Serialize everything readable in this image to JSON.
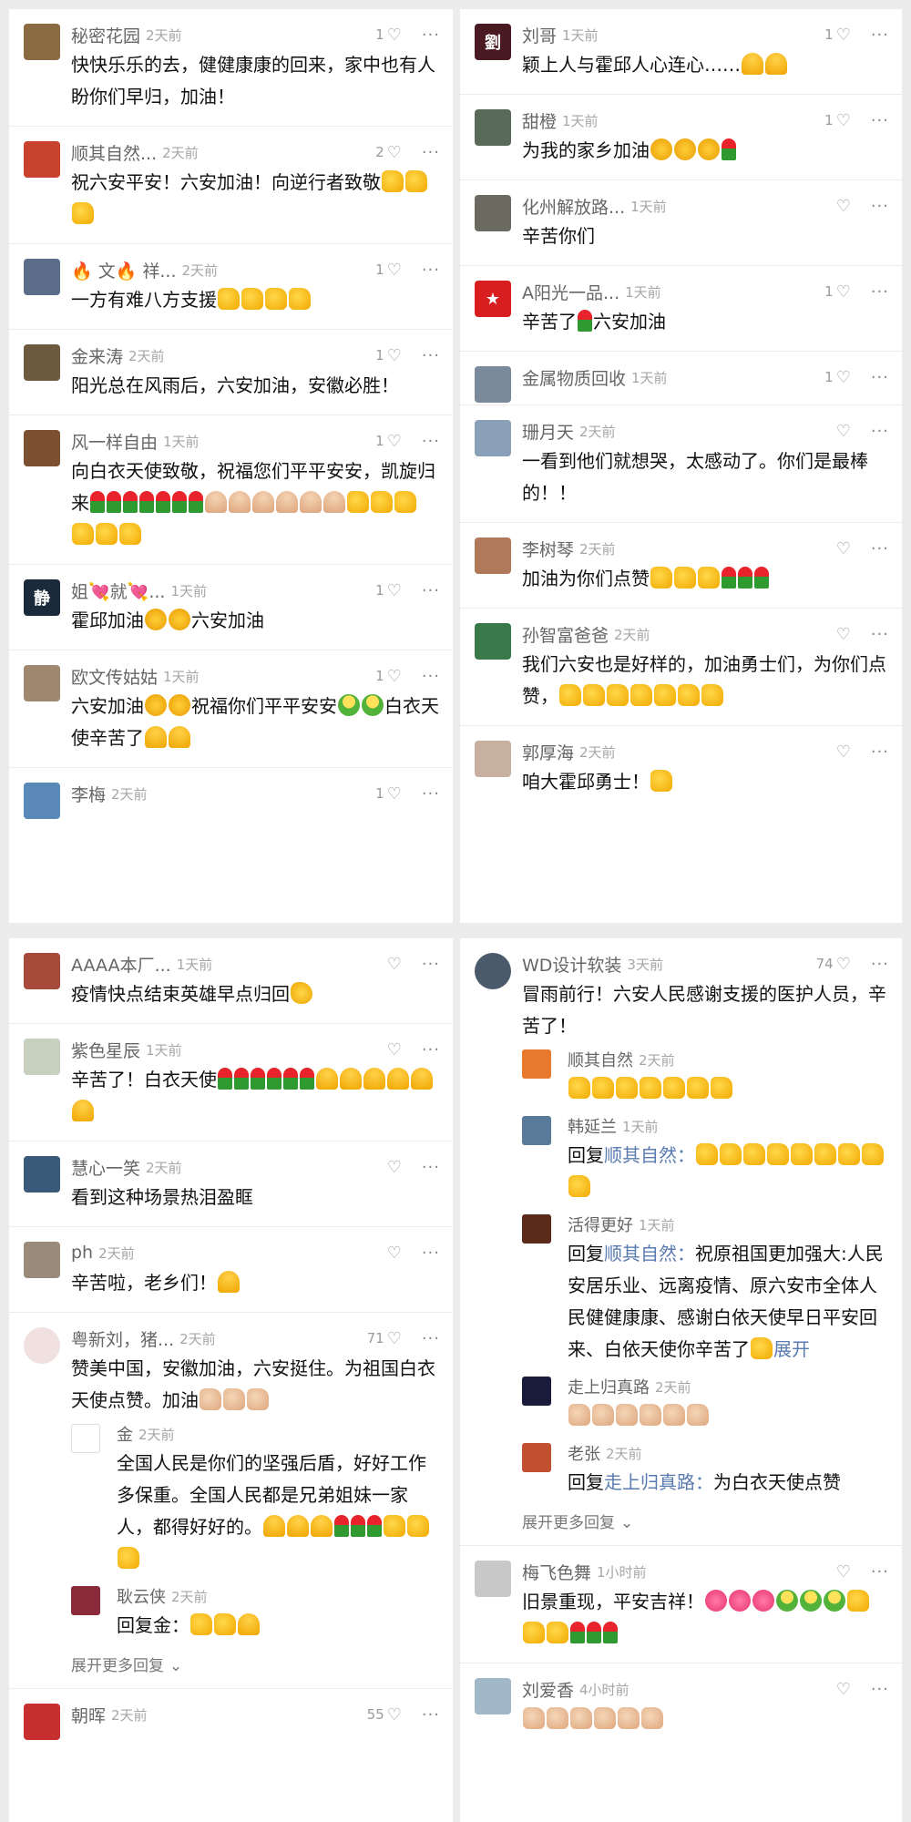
{
  "p1": [
    {
      "name": "秘密花园",
      "time": "2天前",
      "likes": "1",
      "text": "快快乐乐的去，健健康康的回来，家中也有人盼你们早归，加油！",
      "emojis": [],
      "av": "#8a6a40"
    },
    {
      "name": "顺其自然...",
      "time": "2天前",
      "likes": "2",
      "text": "祝六安平安！六安加油！向逆行者致敬",
      "emojis": [
        "thumb",
        "thumb",
        "thumb"
      ],
      "av": "#c8422e"
    },
    {
      "name": "🔥 文🔥 祥...",
      "time": "2天前",
      "likes": "1",
      "text": "一方有难八方支援",
      "emojis": [
        "thumb",
        "thumb",
        "thumb",
        "thumb"
      ],
      "av": "#5b6d88"
    },
    {
      "name": "金来涛",
      "time": "2天前",
      "likes": "1",
      "text": "阳光总在风雨后，六安加油，安徽必胜！",
      "emojis": [],
      "av": "#6b5a3e"
    },
    {
      "name": "风一样自由",
      "time": "1天前",
      "likes": "1",
      "text": "向白衣天使致敬，祝福您们平平安安，凯旋归来",
      "emojis": [
        "rose",
        "rose",
        "rose",
        "rose",
        "rose",
        "rose",
        "rose",
        "prayb",
        "prayb",
        "prayb",
        "prayb",
        "prayb",
        "prayb",
        "thumb",
        "thumb",
        "thumb",
        "thumb",
        "thumb",
        "thumb"
      ],
      "av": "#7a5030"
    },
    {
      "name": "姐💘就💘...",
      "time": "1天前",
      "likes": "1",
      "text": "霍邱加油",
      "emojis": [
        "fist",
        "fist"
      ],
      "text2": "六安加油",
      "av": "#1a2a3a",
      "avtext": "静"
    },
    {
      "name": "欧文传姑姑",
      "time": "1天前",
      "likes": "1",
      "text": "六安加油",
      "emojis": [
        "fist",
        "fist"
      ],
      "text2": "祝福你们平平安安",
      "emojis2": [
        "face",
        "face"
      ],
      "text3": "白衣天使辛苦了",
      "emojis3": [
        "pray",
        "pray"
      ],
      "av": "#a08870"
    },
    {
      "name": "李梅",
      "time": "2天前",
      "likes": "1",
      "text": "",
      "emojis": [],
      "av": "#5a88b8"
    }
  ],
  "p2": [
    {
      "name": "刘哥",
      "time": "1天前",
      "likes": "1",
      "text": "颖上人与霍邱人心连心……",
      "emojis": [
        "pray",
        "pray"
      ],
      "av": "#4a1a22",
      "avtext": "劉"
    },
    {
      "name": "甜橙",
      "time": "1天前",
      "likes": "1",
      "text": "为我的家乡加油",
      "emojis": [
        "fist",
        "fist",
        "fist",
        "rose"
      ],
      "av": "#5a6a58"
    },
    {
      "name": "化州解放路...",
      "time": "1天前",
      "likes": "",
      "text": "辛苦你们",
      "emojis": [],
      "av": "#6a6a60"
    },
    {
      "name": "A阳光一品...",
      "time": "1天前",
      "likes": "1",
      "text": "辛苦了",
      "emojis": [
        "rose"
      ],
      "text2": "六安加油",
      "av": "#d81e1e",
      "avtext": "★"
    },
    {
      "name": "金属物质回收",
      "time": "1天前",
      "likes": "1",
      "text": "",
      "emojis": [],
      "av": "#7a8a9a"
    },
    {
      "name": "珊月天",
      "time": "2天前",
      "likes": "",
      "text": "一看到他们就想哭，太感动了。你们是最棒的！！",
      "emojis": [],
      "av": "#8aa0b8"
    },
    {
      "name": "李树琴",
      "time": "2天前",
      "likes": "",
      "text": "加油为你们点赞",
      "emojis": [
        "thumb",
        "thumb",
        "thumb",
        "rose",
        "rose",
        "rose"
      ],
      "av": "#b07a5a"
    },
    {
      "name": "孙智富爸爸",
      "time": "2天前",
      "likes": "",
      "text": "我们六安也是好样的，加油勇士们，为你们点赞，",
      "emojis": [
        "thumb",
        "thumb",
        "thumb",
        "thumb",
        "thumb",
        "thumb",
        "thumb"
      ],
      "av": "#3a7a4a"
    },
    {
      "name": "郭厚海",
      "time": "2天前",
      "likes": "",
      "text": "咱大霍邱勇士！",
      "emojis": [
        "thumb"
      ],
      "av": "#c8b0a0"
    }
  ],
  "p3": [
    {
      "name": "AAAA本厂...",
      "time": "1天前",
      "likes": "",
      "text": "疫情快点结束英雄早点归回",
      "emojis": [
        "okh"
      ],
      "av": "#a84a3a"
    },
    {
      "name": "紫色星辰",
      "time": "1天前",
      "likes": "",
      "text": "辛苦了！白衣天使",
      "emojis": [
        "rose",
        "rose",
        "rose",
        "rose",
        "rose",
        "rose",
        "pray",
        "pray",
        "pray",
        "pray",
        "pray",
        "pray"
      ],
      "av": "#c8d0c0"
    },
    {
      "name": "慧心一笑",
      "time": "2天前",
      "likes": "",
      "text": "看到这种场景热泪盈眶",
      "emojis": [],
      "av": "#3a5a7a"
    },
    {
      "name": "ph",
      "time": "2天前",
      "likes": "",
      "text": "辛苦啦，老乡们！",
      "emojis": [
        "pray"
      ],
      "av": "#9a8a7a"
    },
    {
      "name": "粤新刘，猪...",
      "time": "2天前",
      "likes": "71",
      "text": "赞美中国，安徽加油，六安挺住。为祖国白衣天使点赞。加油",
      "emojis": [
        "thumbb",
        "thumbb",
        "thumbb"
      ],
      "av": "#f0e0e0",
      "round": true,
      "replies": [
        {
          "name": "金",
          "time": "2天前",
          "text": "全国人民是你们的坚强后盾，好好工作多保重。全国人民都是兄弟姐妹一家人，都得好好的。",
          "emojis": [
            "pray",
            "pray",
            "pray",
            "rose",
            "rose",
            "rose",
            "thumb",
            "thumb",
            "thumb"
          ],
          "av": "#ffffff"
        },
        {
          "name": "耿云侠",
          "time": "2天前",
          "text": "回复金：",
          "emojis": [
            "thumb",
            "thumb",
            "pray"
          ],
          "av": "#8a2a3a"
        }
      ],
      "expand": "展开更多回复"
    },
    {
      "name": "朝晖",
      "time": "2天前",
      "likes": "55",
      "text": "",
      "emojis": [],
      "av": "#c83030"
    }
  ],
  "p4": [
    {
      "name": "WD设计软装",
      "time": "3天前",
      "likes": "74",
      "text": "冒雨前行！六安人民感谢支援的医护人员，辛苦了！",
      "emojis": [],
      "av": "#4a5a6a",
      "round": true,
      "replies": [
        {
          "name": "顺其自然",
          "time": "2天前",
          "text": "",
          "emojis": [
            "thumb",
            "thumb",
            "thumb",
            "thumb",
            "thumb",
            "thumb",
            "thumb"
          ],
          "av": "#e87a30"
        },
        {
          "name": "韩延兰",
          "time": "1天前",
          "text": "回复",
          "rn": "顺其自然：",
          "emojis": [
            "thumb",
            "thumb",
            "thumb",
            "thumb",
            "thumb",
            "thumb",
            "thumb",
            "thumb",
            "thumb"
          ],
          "av": "#5a7a9a"
        },
        {
          "name": "活得更好",
          "time": "1天前",
          "text": "回复",
          "rn": "顺其自然：",
          "text2": "祝原祖国更加强大:人民安居乐业、远离疫情、原六安市全体人民健健康康、感谢白依天使早日平安回来、白依天使你辛苦了",
          "emojis": [
            "thumb"
          ],
          "tail": "展开",
          "av": "#5a2a1a"
        },
        {
          "name": "走上归真路",
          "time": "2天前",
          "text": "",
          "emojis": [
            "thumbb",
            "thumbb",
            "thumbb",
            "thumbb",
            "thumbb",
            "thumbb"
          ],
          "av": "#1a1a3a"
        },
        {
          "name": "老张",
          "time": "2天前",
          "text": "回复",
          "rn": "走上归真路：",
          "text2": "为白衣天使点赞",
          "emojis": [],
          "av": "#c05030"
        }
      ],
      "expand": "展开更多回复"
    },
    {
      "name": "梅飞色舞",
      "time": "1小时前",
      "likes": "",
      "text": "旧景重现，平安吉祥！",
      "emojis": [
        "heart",
        "heart",
        "heart",
        "face",
        "face",
        "face",
        "thumb",
        "thumb",
        "thumb",
        "rose",
        "rose",
        "rose"
      ],
      "av": "#c8c8c8"
    },
    {
      "name": "刘爱香",
      "time": "4小时前",
      "likes": "",
      "text": "",
      "emojis": [
        "thumbb",
        "thumbb",
        "thumbb",
        "thumbb",
        "thumbb",
        "thumbb"
      ],
      "av": "#a0b8c8"
    }
  ],
  "icons": {
    "heart": "♡",
    "more": "···",
    "chevron": "⌄"
  }
}
